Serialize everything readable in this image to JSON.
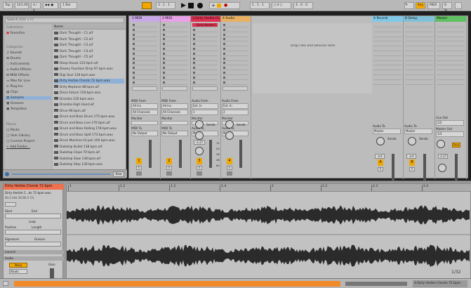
{
  "transport": {
    "tap": "Tap",
    "tempo": "141.00",
    "signature": "4 / 4",
    "quantize": "1 Bar",
    "position": "3 . 1 . 1",
    "loop_start": "1 . 1 . 1",
    "loop_length": "4 . 0 . 0",
    "key": "Key",
    "midi": "MIDI",
    "cpu": "8 %",
    "accent_color": "#f0a800"
  },
  "browser": {
    "search_placeholder": "Search (Ctrl + F)",
    "collections_header": "Collections",
    "favorites": "Favorites",
    "categories_header": "Categories",
    "categories": [
      "Sounds",
      "Drums",
      "Instruments",
      "Audio Effects",
      "MIDI Effects",
      "Max for Live",
      "Plug-Ins",
      "Clips",
      "Samples",
      "Grooves",
      "Templates"
    ],
    "places_header": "Places",
    "places": [
      "Packs",
      "User Library",
      "Current Project",
      "Add Folder..."
    ],
    "name_header": "Name",
    "files": [
      "Dark Thought - C1.aif",
      "Dark Thought - C2.aif",
      "Dark Thought - C3.aif",
      "Dark Thought - C4.aif",
      "Dark Thought - C5.aif",
      "Deep House 120 bpm.aif",
      "Dewey Fountain Drop 97 bpm.wav",
      "Digi Soul 128 bpm.wav",
      "Dirty Herbie Chords 72 bpm.wav",
      "Dirty Neptune 88 bpm.aif",
      "Disco Future 118 bpm.wav",
      "Dramba 120 bpm.wav",
      "Dramba High Hand.aif",
      "Drive 96 bpm.aif",
      "Drum and Bass Drum 175 bpm.wav",
      "Drum and Bass Live 170 bpm.aif",
      "Drum and Bass Rolling 178 bpm.wav",
      "Drum and Bass Split 173 bpm.wav",
      "Drum Machine Hi-yah 100 bpm.wav",
      "Dubstep Bullet 138 bpm.aif",
      "Dubstep Claps 70 bpm.aif",
      "Dubstep Slow 138 bpm.aif",
      "Dubstep Step 138 bpm.wav"
    ],
    "selected_file_index": 8,
    "raw_label": "Raw"
  },
  "session": {
    "drop_hint": "Drop Files and Devices Here",
    "tracks": [
      {
        "name": "1 MIDI",
        "color": "#c8a8e8",
        "input_header": "MIDI From",
        "input": "All Ins",
        "channel": "All Channels",
        "monitor": "Monitor",
        "output_header": "MIDI To",
        "output": "No Output",
        "number": "1"
      },
      {
        "name": "2 MIDI",
        "color": "#e8a0e8",
        "input_header": "MIDI From",
        "input": "All Ins",
        "channel": "All Channels",
        "monitor": "Monitor",
        "output_header": "MIDI To",
        "output": "No Output",
        "number": "2"
      },
      {
        "name": "3 Dirty Herbie Ch",
        "color": "#e03050",
        "clip": "Dirty Herbie C",
        "input_header": "Audio From",
        "input": "Ext. In",
        "channel": "1",
        "monitor": "Monitor",
        "output_header": "Audio To",
        "output": "Master",
        "volume": "-2.27",
        "number": "3"
      },
      {
        "name": "4 Audio",
        "color": "#e8b060",
        "input_header": "Audio From",
        "input": "Ext. In",
        "channel": "2",
        "monitor": "Monitor",
        "output_header": "Audio To",
        "output": "Master",
        "number": "4"
      }
    ],
    "returns": [
      {
        "name": "A Reverb",
        "color": "#80c8e8",
        "output_header": "Audio To",
        "output": "Master",
        "volume": "-inf",
        "letter": "A"
      },
      {
        "name": "B Delay",
        "color": "#80c0d8",
        "output_header": "Audio To",
        "output": "Master",
        "volume": "-inf",
        "letter": "B"
      }
    ],
    "master": {
      "name": "Master",
      "color": "#60c060",
      "cue_header": "Cue Out",
      "cue": "1/2",
      "out_header": "Master Out",
      "out": "1/2",
      "volume": "-2.27",
      "post": "Post"
    },
    "sends_label": "Sends",
    "solo_label": "S",
    "meter_marks": [
      "12",
      "24",
      "36",
      "48",
      "60"
    ]
  },
  "detail": {
    "clip_name": "Dirty Herbie Chords 72 bpm",
    "file_label": "Dirty Herbie C...ds 72 bpm.wav",
    "sample_info": "44.1 kHz 16 Bit 2 Ch",
    "signature_label": "Signature",
    "groove_label": "Groove",
    "start_label": "Start",
    "end_label": "End",
    "loop_label": "Loop",
    "position_label": "Position",
    "length_label": "Length",
    "warp_label": "Warp",
    "mode": "Beats",
    "gain_label": "Gain",
    "launch_label": "Launch",
    "audio_label": "Audio",
    "ruler_marks": [
      "1",
      "1.2",
      "1.3",
      "1.4",
      "2",
      "2.2",
      "2.3",
      "2.4"
    ],
    "zoom": "1/32",
    "status_clip": "3-Dirty Herbie Chords 72 bpm"
  }
}
